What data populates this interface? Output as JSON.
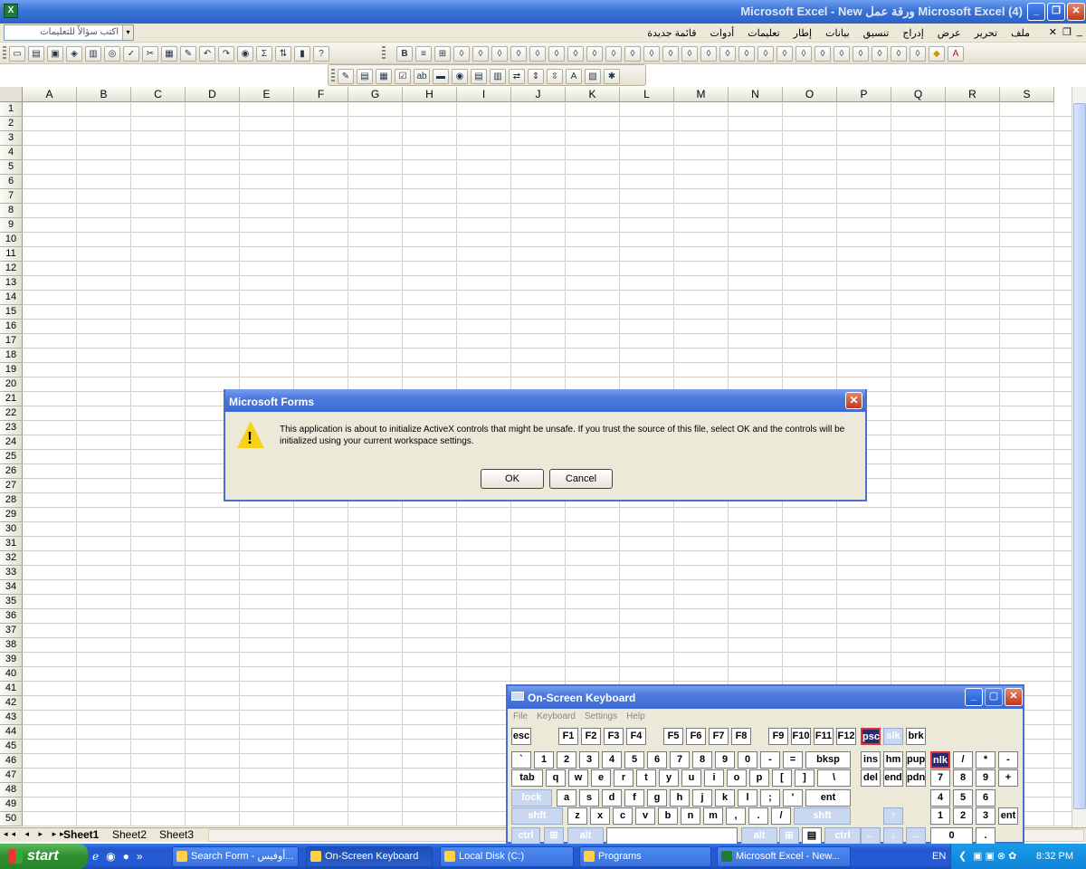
{
  "window": {
    "title": "Microsoft Excel - New ورقة عمل Microsoft Excel (4)",
    "app_icon": "X"
  },
  "menubar": {
    "help_placeholder": "اكتب سؤالاً للتعليمات",
    "items": [
      "ملف",
      "تحرير",
      "عرض",
      "إدراج",
      "تنسيق",
      "بيانات",
      "إطار",
      "تعليمات",
      "أدوات",
      "قائمة جديدة"
    ]
  },
  "toolbar": {
    "bold": "B",
    "sigma": "Σ"
  },
  "sheet": {
    "columns": [
      "A",
      "B",
      "C",
      "D",
      "E",
      "F",
      "G",
      "H",
      "I",
      "J",
      "K",
      "L",
      "M",
      "N",
      "O",
      "P",
      "Q",
      "R",
      "S"
    ],
    "rows": [
      "1",
      "2",
      "3",
      "4",
      "5",
      "6",
      "7",
      "8",
      "9",
      "10",
      "11",
      "12",
      "13",
      "14",
      "15",
      "16",
      "17",
      "18",
      "19",
      "20",
      "21",
      "22",
      "23",
      "24",
      "25",
      "26",
      "27",
      "28",
      "29",
      "30",
      "31",
      "32",
      "33",
      "34",
      "35",
      "36",
      "37",
      "38",
      "39",
      "40",
      "41",
      "42",
      "43",
      "44",
      "45",
      "46",
      "47",
      "48",
      "49",
      "50"
    ],
    "tabs": [
      "Sheet1",
      "Sheet2",
      "Sheet3"
    ],
    "tab_nav": "◂◂ ◂ ▸ ▸▸"
  },
  "dialog": {
    "title": "Microsoft Forms",
    "message": "This application is about to initialize ActiveX controls that might be unsafe. If you trust the source of this file, select OK and the controls will be initialized using your current workspace settings.",
    "ok": "OK",
    "cancel": "Cancel",
    "warning_mark": "!"
  },
  "osk": {
    "title": "On-Screen Keyboard",
    "menu": [
      "File",
      "Keyboard",
      "Settings",
      "Help"
    ]
  },
  "taskbar": {
    "start": "start",
    "buttons": [
      "Search Form - أوفيس...",
      "On-Screen Keyboard",
      "Local Disk (C:)",
      "Programs",
      "Microsoft Excel - New..."
    ],
    "lang": "EN",
    "clock": "8:32 PM"
  }
}
